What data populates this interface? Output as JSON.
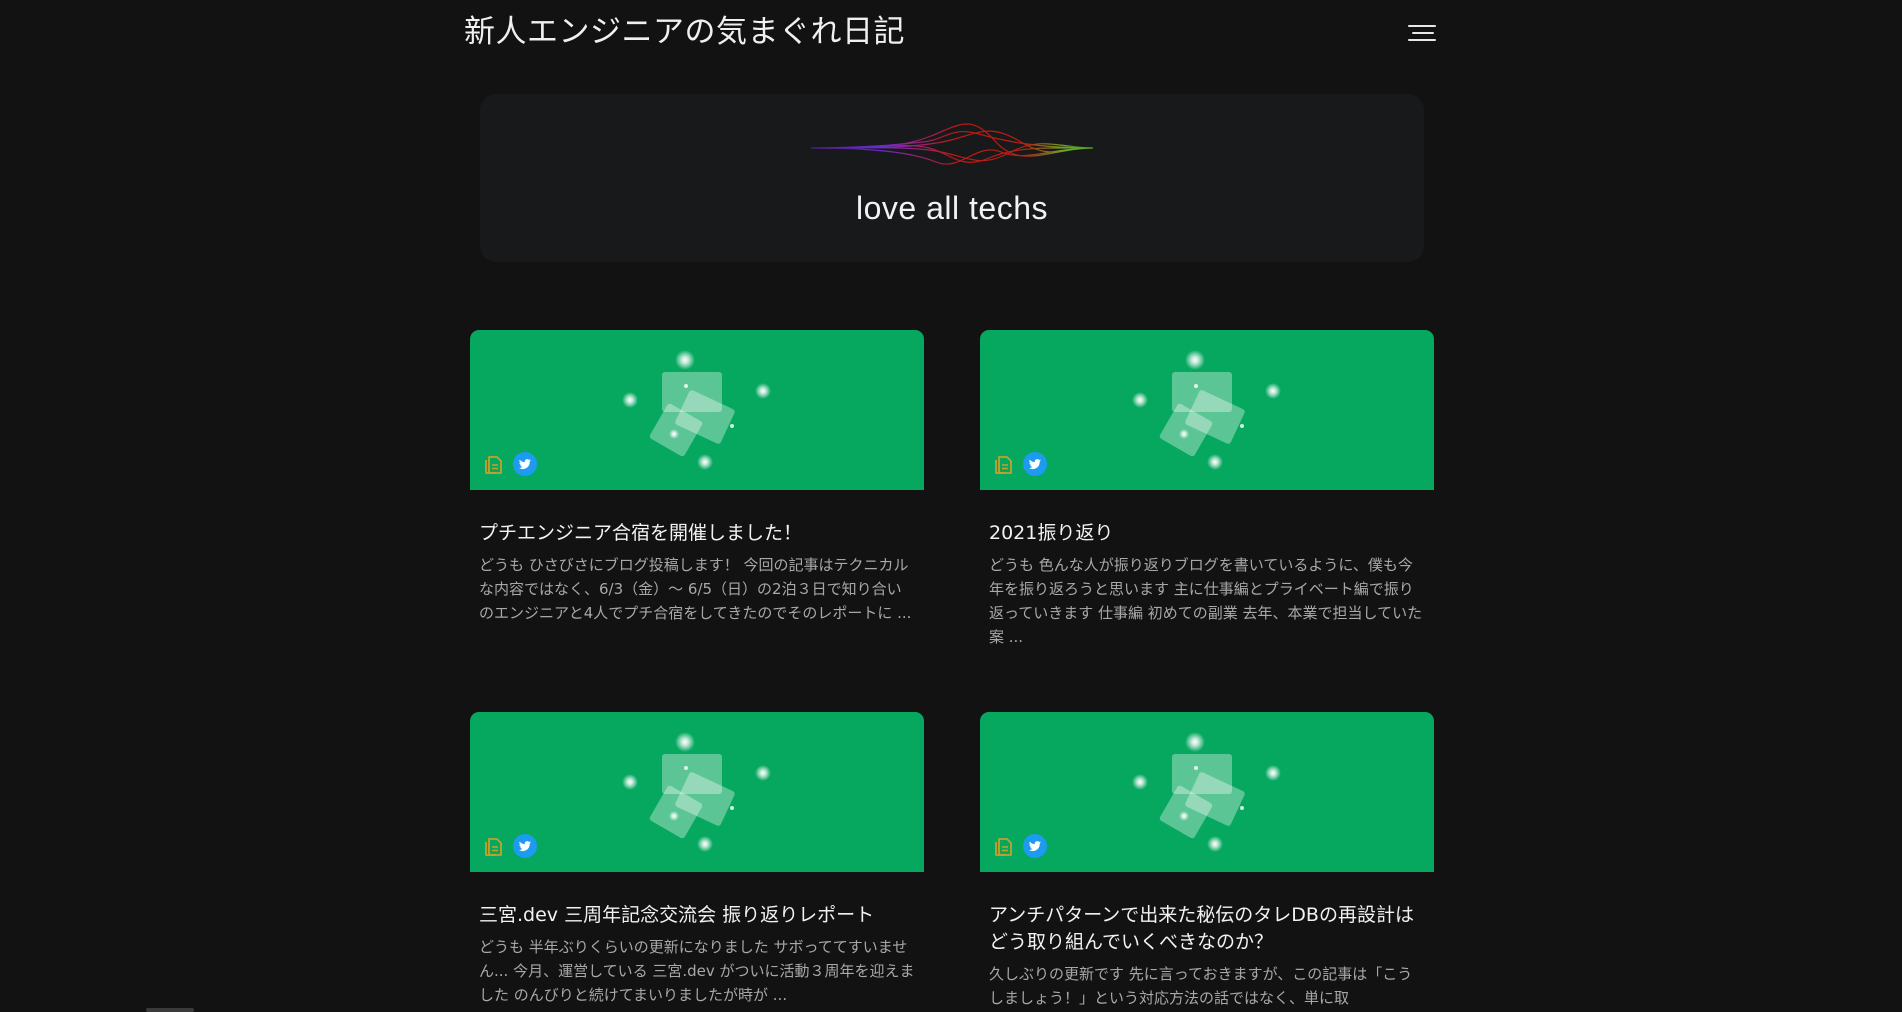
{
  "header": {
    "site_title": "新人エンジニアの気まぐれ日記"
  },
  "hero": {
    "tagline": "love all techs"
  },
  "colors": {
    "background": "#121212",
    "hero_background": "#18191b",
    "thumbnail_green": "#06a75f",
    "copy_icon": "#c8a028",
    "twitter_blue": "#1d9bf0"
  },
  "icons": {
    "menu": "hamburger-icon",
    "copy": "document-copy-icon",
    "share": "twitter-icon"
  },
  "posts": [
    {
      "title": "プチエンジニア合宿を開催しました！",
      "excerpt": "どうも ひさびさにブログ投稿します！ 今回の記事はテクニカルな内容ではなく、6/3（金）～ 6/5（日）の2泊３日で知り合いのエンジニアと4人でプチ合宿をしてきたのでそのレポートに ..."
    },
    {
      "title": "2021振り返り",
      "excerpt": "どうも 色んな人が振り返りブログを書いているように、僕も今年を振り返ろうと思います 主に仕事編とプライベート編で振り返っていきます 仕事編 初めての副業 去年、本業で担当していた案 ..."
    },
    {
      "title": "三宮.dev 三周年記念交流会 振り返りレポート",
      "excerpt": "どうも 半年ぶりくらいの更新になりました サボっててすいません... 今月、運営している 三宮.dev がついに活動３周年を迎えました のんびりと続けてまいりましたが時が ..."
    },
    {
      "title": "アンチパターンで出来た秘伝のタレDBの再設計はどう取り組んでいくべきなのか？",
      "excerpt": "久しぶりの更新です 先に言っておきますが、この記事は「こうしましょう！」という対応方法の話ではなく、単に取"
    }
  ]
}
